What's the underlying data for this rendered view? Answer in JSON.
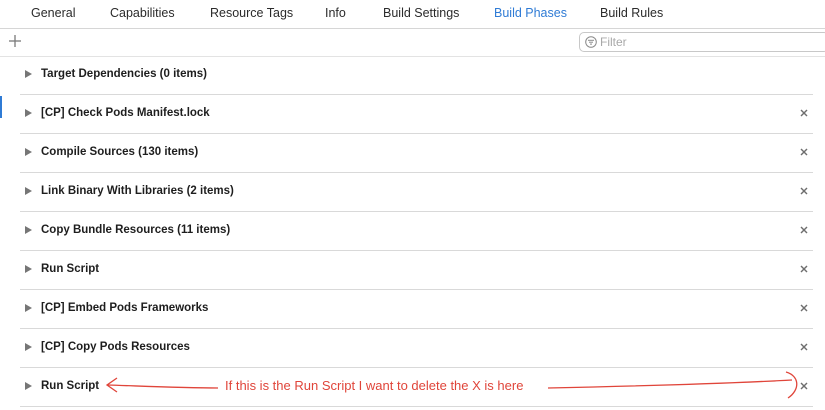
{
  "tabs": [
    {
      "label": "General",
      "active": false
    },
    {
      "label": "Capabilities",
      "active": false
    },
    {
      "label": "Resource Tags",
      "active": false
    },
    {
      "label": "Info",
      "active": false
    },
    {
      "label": "Build Settings",
      "active": false
    },
    {
      "label": "Build Phases",
      "active": true
    },
    {
      "label": "Build Rules",
      "active": false
    }
  ],
  "toolbar": {
    "add_icon": "plus-icon",
    "filter_placeholder": "Filter",
    "filter_icon": "filter-icon"
  },
  "phases": [
    {
      "title": "Target Dependencies (0 items)",
      "deletable": false
    },
    {
      "title": "[CP] Check Pods Manifest.lock",
      "deletable": true
    },
    {
      "title": "Compile Sources (130 items)",
      "deletable": true
    },
    {
      "title": "Link Binary With Libraries (2 items)",
      "deletable": true
    },
    {
      "title": "Copy Bundle Resources (11 items)",
      "deletable": true
    },
    {
      "title": "Run Script",
      "deletable": true
    },
    {
      "title": "[CP] Embed Pods Frameworks",
      "deletable": true
    },
    {
      "title": "[CP] Copy Pods Resources",
      "deletable": true
    },
    {
      "title": "Run Script",
      "deletable": true
    }
  ],
  "annotation": {
    "text": "If this is the Run Script I want to delete the X is here",
    "color": "#e0453a"
  },
  "colors": {
    "accent": "#2f7bd5",
    "text": "#1e1e1e",
    "divider": "#d9d9d9"
  }
}
